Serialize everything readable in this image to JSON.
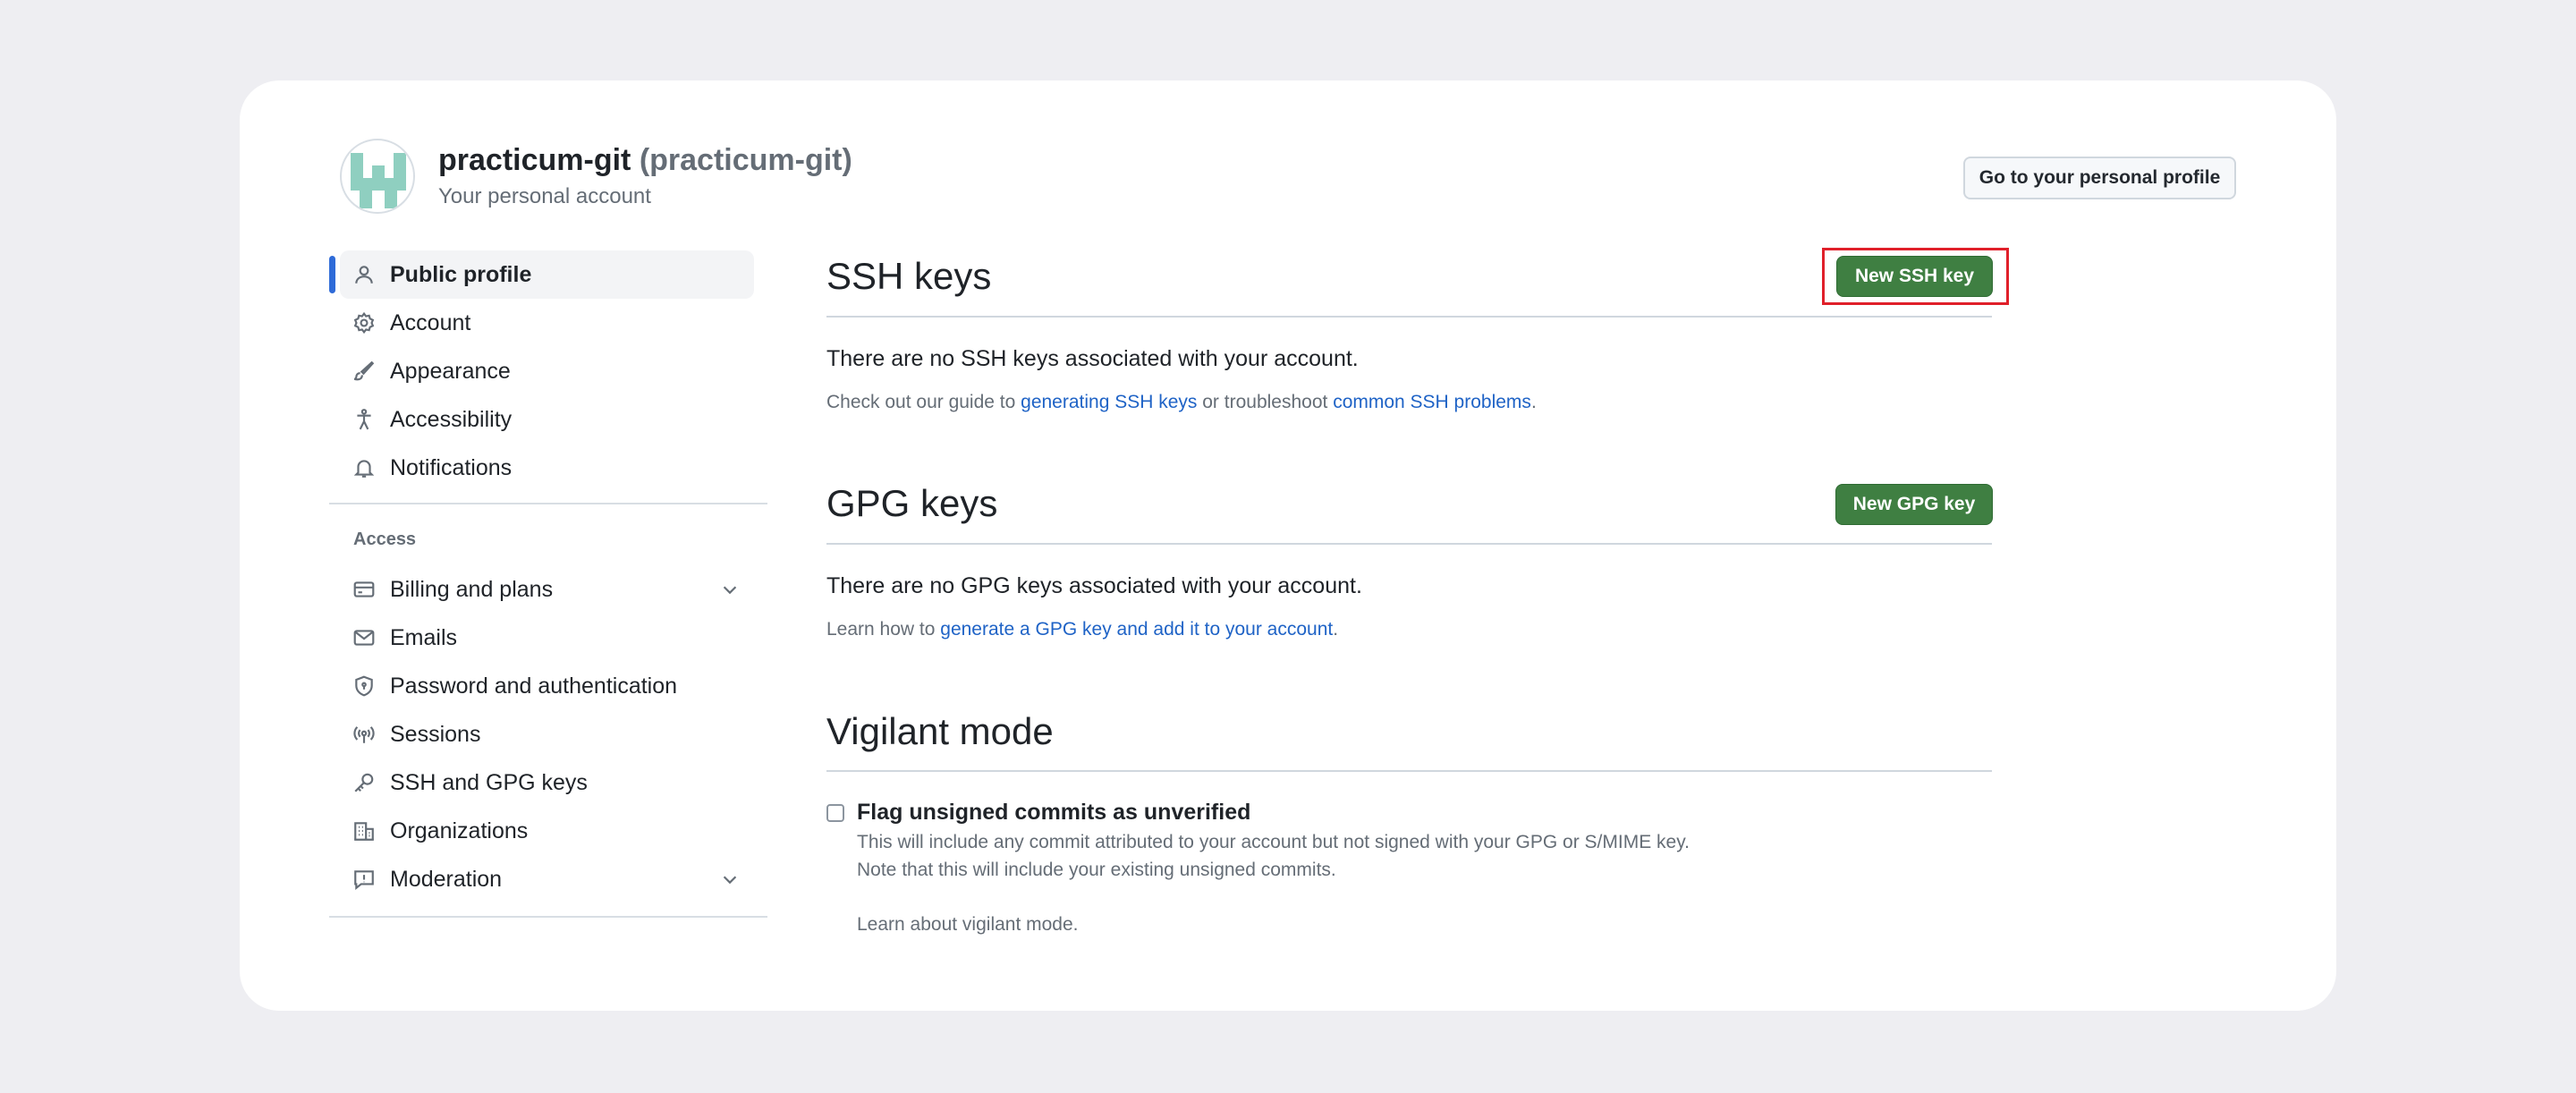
{
  "header": {
    "display_name": "practicum-git",
    "login": "(practicum-git)",
    "subtitle": "Your personal account",
    "profile_button": "Go to your personal profile"
  },
  "sidebar": {
    "items": [
      {
        "label": "Public profile",
        "icon": "person-icon",
        "active": true
      },
      {
        "label": "Account",
        "icon": "gear-icon"
      },
      {
        "label": "Appearance",
        "icon": "paintbrush-icon"
      },
      {
        "label": "Accessibility",
        "icon": "accessibility-icon"
      },
      {
        "label": "Notifications",
        "icon": "bell-icon"
      }
    ],
    "access_heading": "Access",
    "access_items": [
      {
        "label": "Billing and plans",
        "icon": "credit-card-icon",
        "expandable": true
      },
      {
        "label": "Emails",
        "icon": "mail-icon"
      },
      {
        "label": "Password and authentication",
        "icon": "shield-icon"
      },
      {
        "label": "Sessions",
        "icon": "broadcast-icon"
      },
      {
        "label": "SSH and GPG keys",
        "icon": "key-icon"
      },
      {
        "label": "Organizations",
        "icon": "organization-icon"
      },
      {
        "label": "Moderation",
        "icon": "report-icon",
        "expandable": true
      }
    ]
  },
  "ssh": {
    "title": "SSH keys",
    "new_button": "New SSH key",
    "empty_text": "There are no SSH keys associated with your account.",
    "guide_prefix": "Check out our guide to ",
    "guide_link": "generating SSH keys",
    "guide_middle": " or troubleshoot ",
    "troubleshoot_link": "common SSH problems",
    "guide_suffix": "."
  },
  "gpg": {
    "title": "GPG keys",
    "new_button": "New GPG key",
    "empty_text": "There are no GPG keys associated with your account.",
    "learn_prefix": "Learn how to ",
    "learn_link": "generate a GPG key and add it to your account",
    "learn_suffix": "."
  },
  "vigilant": {
    "title": "Vigilant mode",
    "checkbox_label": "Flag unsigned commits as unverified",
    "note_line1": "This will include any commit attributed to your account but not signed with your GPG or S/MIME key.",
    "note_line2": "Note that this will include your existing unsigned commits.",
    "learn_link": "Learn about vigilant mode."
  },
  "colors": {
    "primary_button": "#3f7f42",
    "link": "#1f63c6",
    "active_bar": "#2f6bd8",
    "highlight": "#e0202a"
  }
}
